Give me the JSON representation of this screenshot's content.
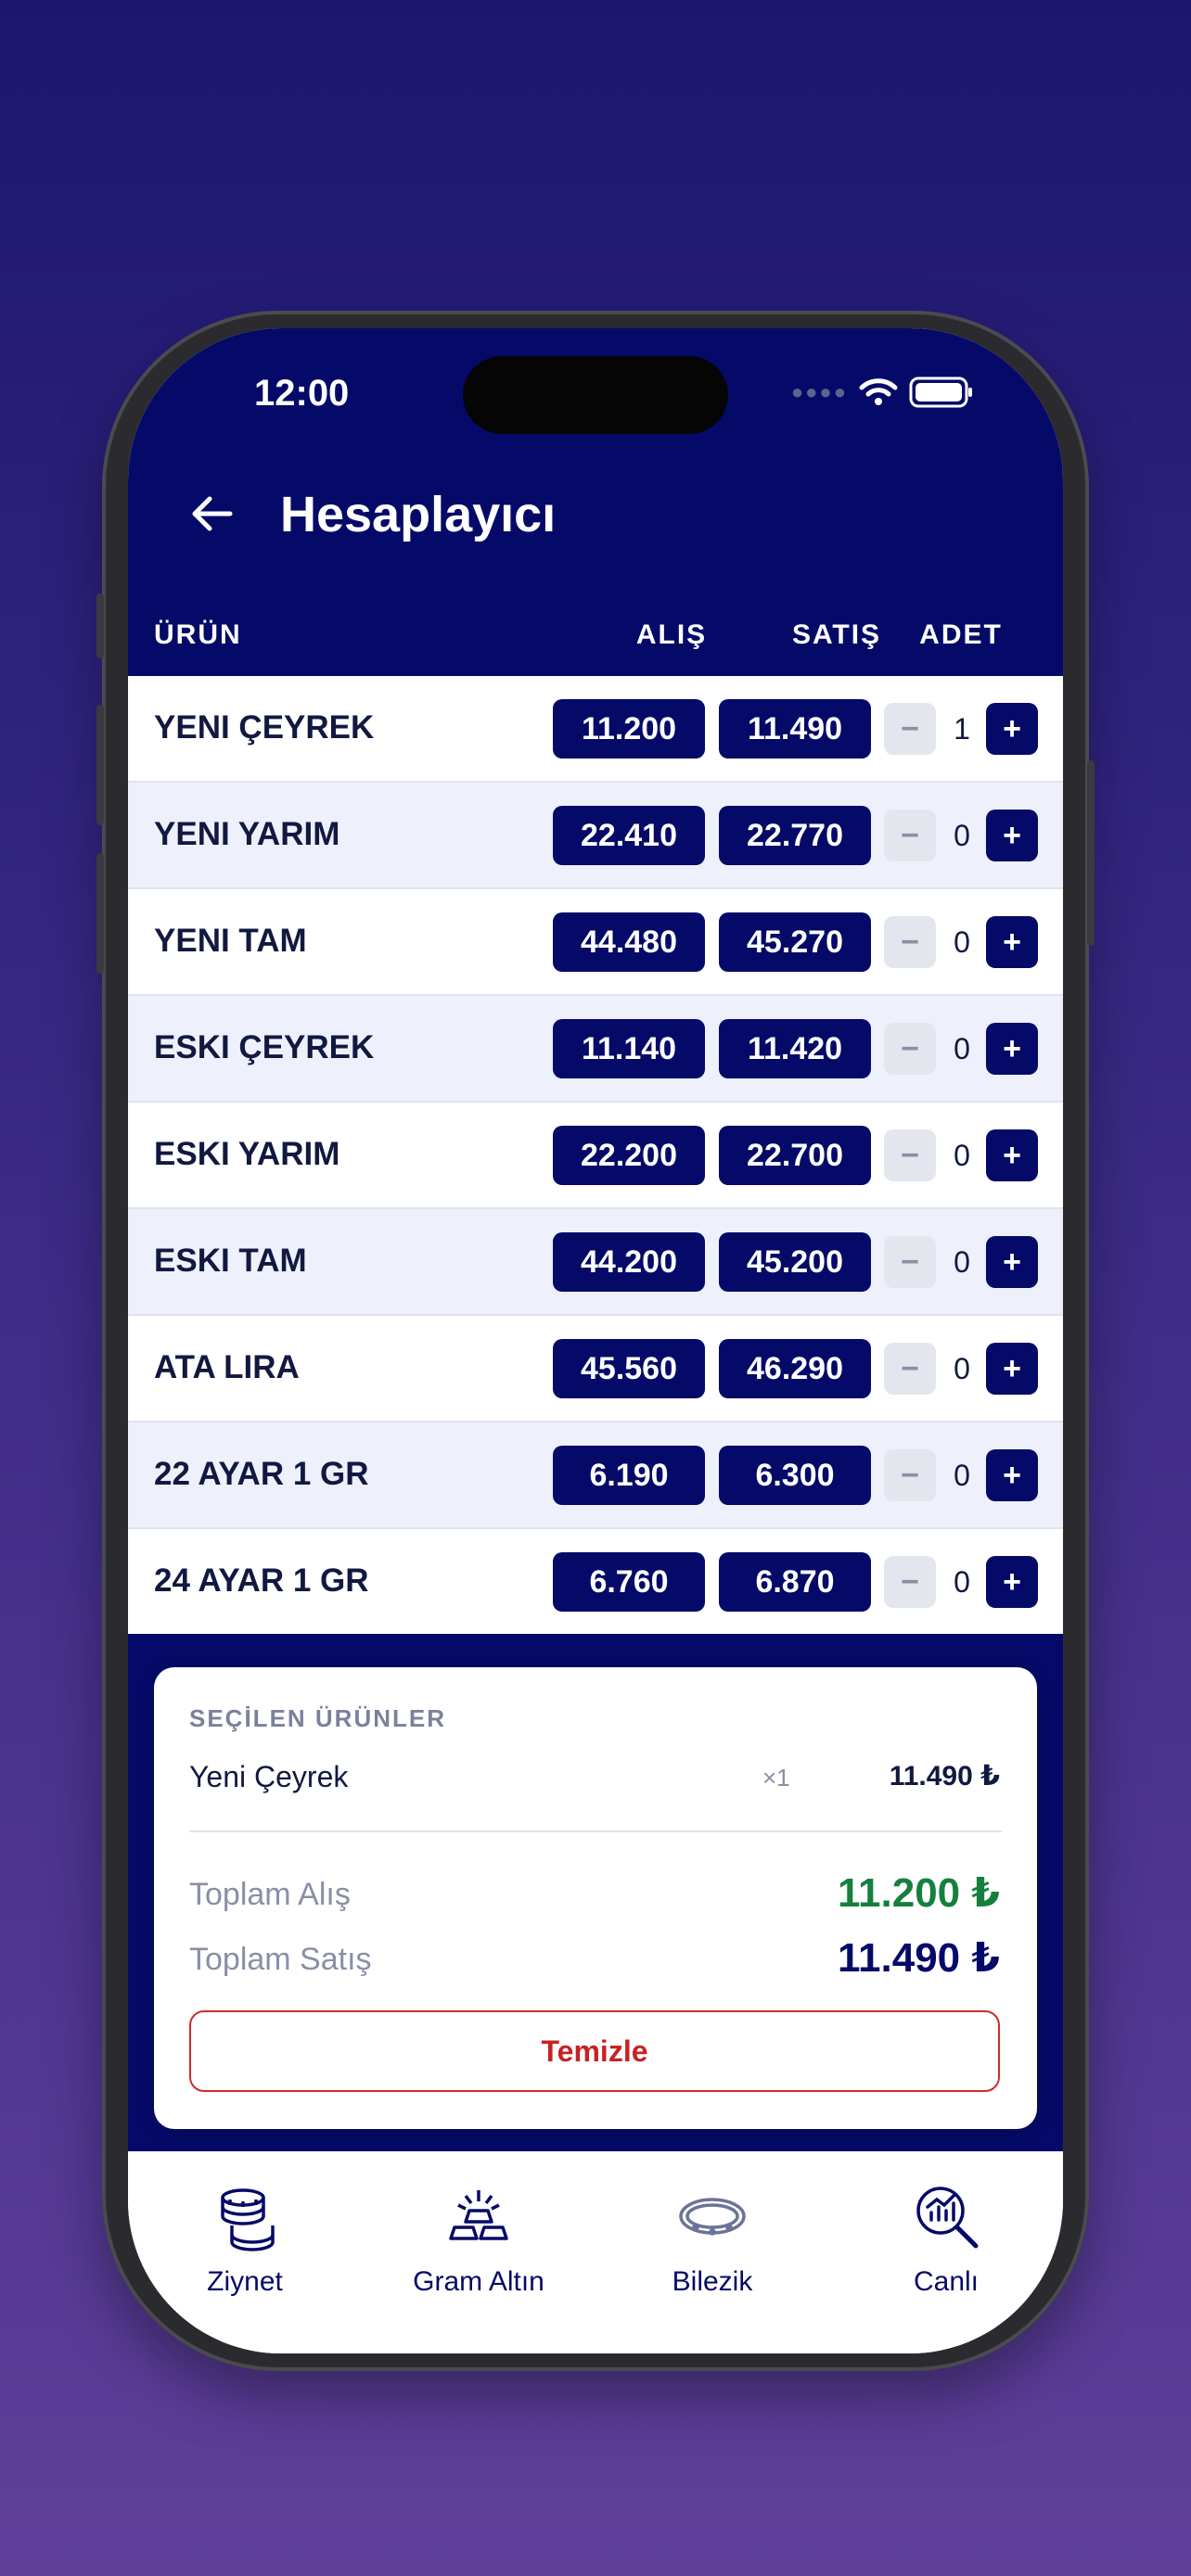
{
  "status": {
    "time": "12:00"
  },
  "header": {
    "title": "Hesaplayıcı"
  },
  "columns": {
    "product": "ÜRÜN",
    "buy": "ALIŞ",
    "sell": "SATIŞ",
    "qty": "ADET"
  },
  "products": [
    {
      "name": "YENI ÇEYREK",
      "buy": "11.200",
      "sell": "11.490",
      "qty": "1"
    },
    {
      "name": "YENI YARIM",
      "buy": "22.410",
      "sell": "22.770",
      "qty": "0"
    },
    {
      "name": "YENI TAM",
      "buy": "44.480",
      "sell": "45.270",
      "qty": "0"
    },
    {
      "name": "ESKI ÇEYREK",
      "buy": "11.140",
      "sell": "11.420",
      "qty": "0"
    },
    {
      "name": "ESKI YARIM",
      "buy": "22.200",
      "sell": "22.700",
      "qty": "0"
    },
    {
      "name": "ESKI TAM",
      "buy": "44.200",
      "sell": "45.200",
      "qty": "0"
    },
    {
      "name": "ATA LIRA",
      "buy": "45.560",
      "sell": "46.290",
      "qty": "0"
    },
    {
      "name": "22 AYAR 1 GR",
      "buy": "6.190",
      "sell": "6.300",
      "qty": "0"
    },
    {
      "name": "24 AYAR 1 GR",
      "buy": "6.760",
      "sell": "6.870",
      "qty": "0"
    }
  ],
  "stepper": {
    "minus": "−",
    "plus": "+"
  },
  "summary": {
    "heading": "SEÇİLEN ÜRÜNLER",
    "selected": [
      {
        "name": "Yeni Çeyrek",
        "multiplier": "×1",
        "price": "11.490 ₺"
      }
    ],
    "total_buy_label": "Toplam Alış",
    "total_buy_value": "11.200 ₺",
    "total_sell_label": "Toplam Satış",
    "total_sell_value": "11.490 ₺",
    "clear_label": "Temizle"
  },
  "tabs": [
    {
      "label": "Ziynet",
      "icon": "coins-icon"
    },
    {
      "label": "Gram Altın",
      "icon": "gold-bars-icon"
    },
    {
      "label": "Bilezik",
      "icon": "bracelet-icon"
    },
    {
      "label": "Canlı",
      "icon": "live-chart-search-icon"
    }
  ],
  "colors": {
    "primary": "#050a68",
    "alt_row": "#eef0fb",
    "buy_total": "#15803d",
    "clear": "#c62323"
  }
}
